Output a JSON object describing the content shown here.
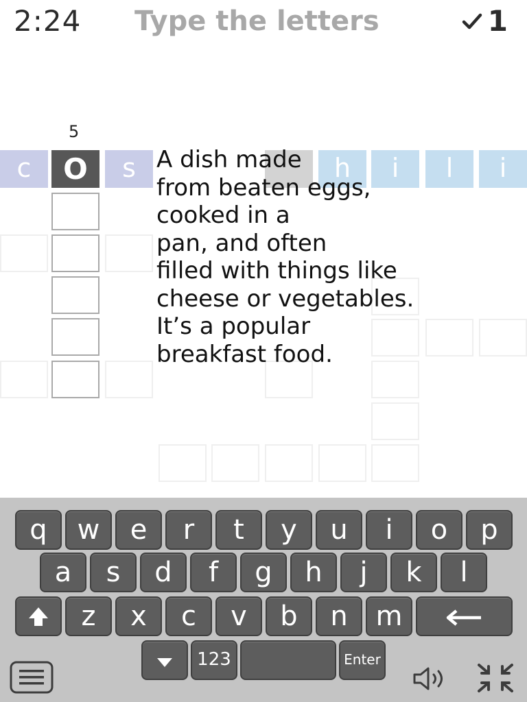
{
  "header": {
    "timer": "2:24",
    "title": "Type the letters",
    "score": "1"
  },
  "clue": {
    "number": "5",
    "lines": "A dish made\nfrom beaten eggs,\ncooked in a\npan, and often\nfilled with things like\ncheese or vegetables.\nIt’s a popular\nbreakfast food."
  },
  "grid": {
    "row_letters": [
      "c",
      "o",
      "s",
      "h",
      "i",
      "l",
      "i"
    ],
    "active_letter": "O"
  },
  "keyboard": {
    "row1": [
      "q",
      "w",
      "e",
      "r",
      "t",
      "y",
      "u",
      "i",
      "o",
      "p"
    ],
    "row2": [
      "a",
      "s",
      "d",
      "f",
      "g",
      "h",
      "j",
      "k",
      "l"
    ],
    "row3": [
      "z",
      "x",
      "c",
      "v",
      "b",
      "n",
      "m"
    ],
    "numbers_label": "123",
    "enter_label": "Enter"
  },
  "icons": [
    "check-icon",
    "shift-icon",
    "backspace-icon",
    "hide-keyboard-icon",
    "menu-icon",
    "speaker-icon",
    "collapse-icon"
  ],
  "colors": {
    "active_cell": "#575757",
    "filled_letter_cell": "#c9cde8",
    "hint_letter_cell": "#c5def0",
    "key": "#5d5d5d",
    "keyboard_bg": "#c4c4c4"
  }
}
